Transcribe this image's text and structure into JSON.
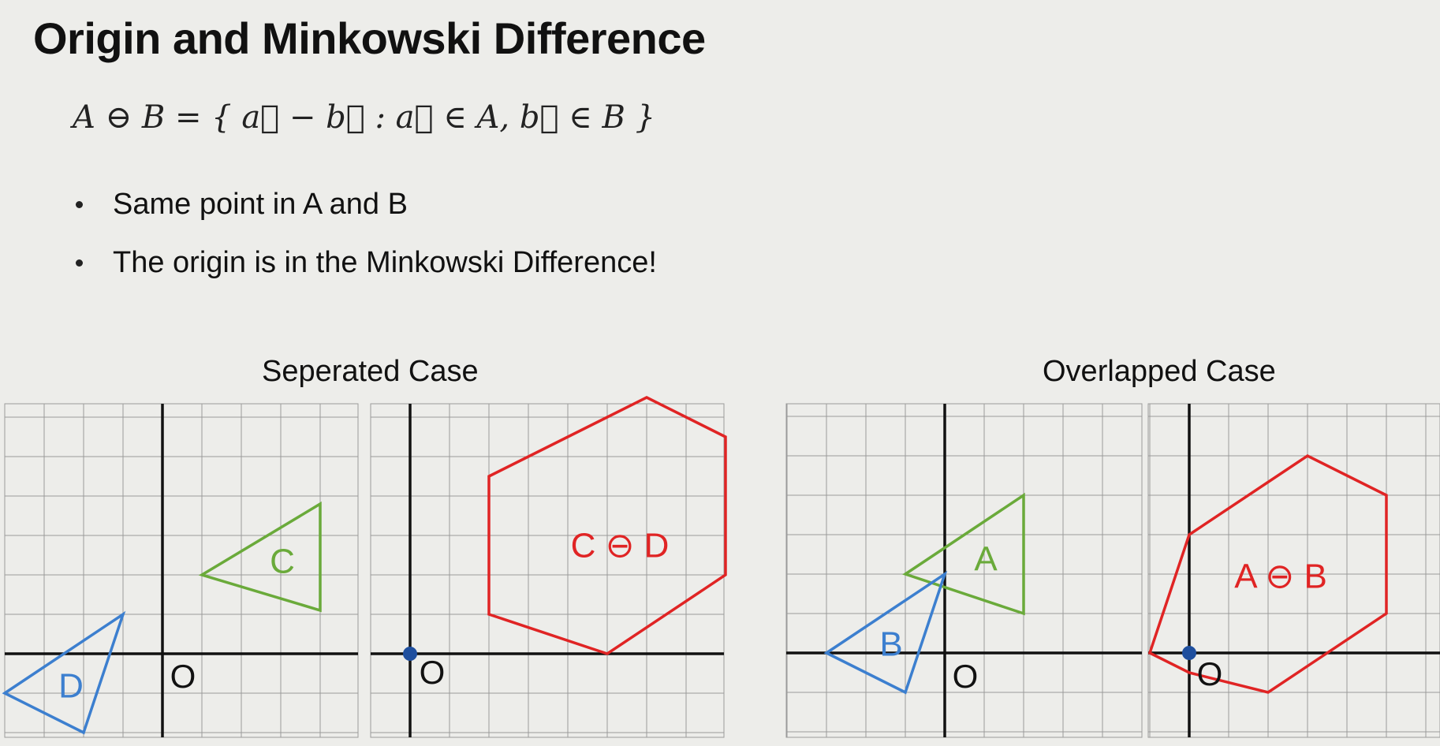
{
  "title": "Origin and Minkowski Difference",
  "formula": "A ⊖ B = { a⃗ − b⃗ : a⃗ ∈ A, b⃗ ∈ B }",
  "bullets": [
    "Same point in A and B",
    "The origin is in the Minkowski Difference!"
  ],
  "cases": {
    "separated": "Seperated Case",
    "overlapped": "Overlapped Case"
  },
  "labels": {
    "origin": "O",
    "C": "C",
    "D": "D",
    "C_minus_D": "C ⊖ D",
    "A": "A",
    "B": "B",
    "A_minus_B": "A ⊖ B"
  },
  "colors": {
    "green": "#6aaa3a",
    "blue": "#3c7fcf",
    "red": "#e02424",
    "axis": "#111111",
    "grid": "#9a9a9a",
    "origin_dot": "#1f4f9e"
  },
  "shapes": {
    "C": [
      [
        1,
        2
      ],
      [
        4,
        3.8
      ],
      [
        4,
        1.1
      ]
    ],
    "D": [
      [
        -4,
        -1
      ],
      [
        -1,
        1
      ],
      [
        -2,
        -2
      ]
    ],
    "C_minus_D": [
      [
        2,
        4.5
      ],
      [
        6,
        6.5
      ],
      [
        8,
        5.5
      ],
      [
        8,
        2
      ],
      [
        5,
        0
      ],
      [
        2,
        1
      ]
    ],
    "A": [
      [
        -1,
        2
      ],
      [
        2,
        4
      ],
      [
        2,
        1
      ]
    ],
    "B": [
      [
        -3,
        0
      ],
      [
        0,
        2
      ],
      [
        -1,
        -1
      ]
    ],
    "A_minus_B": [
      [
        0,
        3
      ],
      [
        3,
        5
      ],
      [
        5,
        4
      ],
      [
        5,
        1
      ],
      [
        2,
        -1
      ],
      [
        0,
        -0.5
      ],
      [
        -1,
        0
      ]
    ]
  }
}
